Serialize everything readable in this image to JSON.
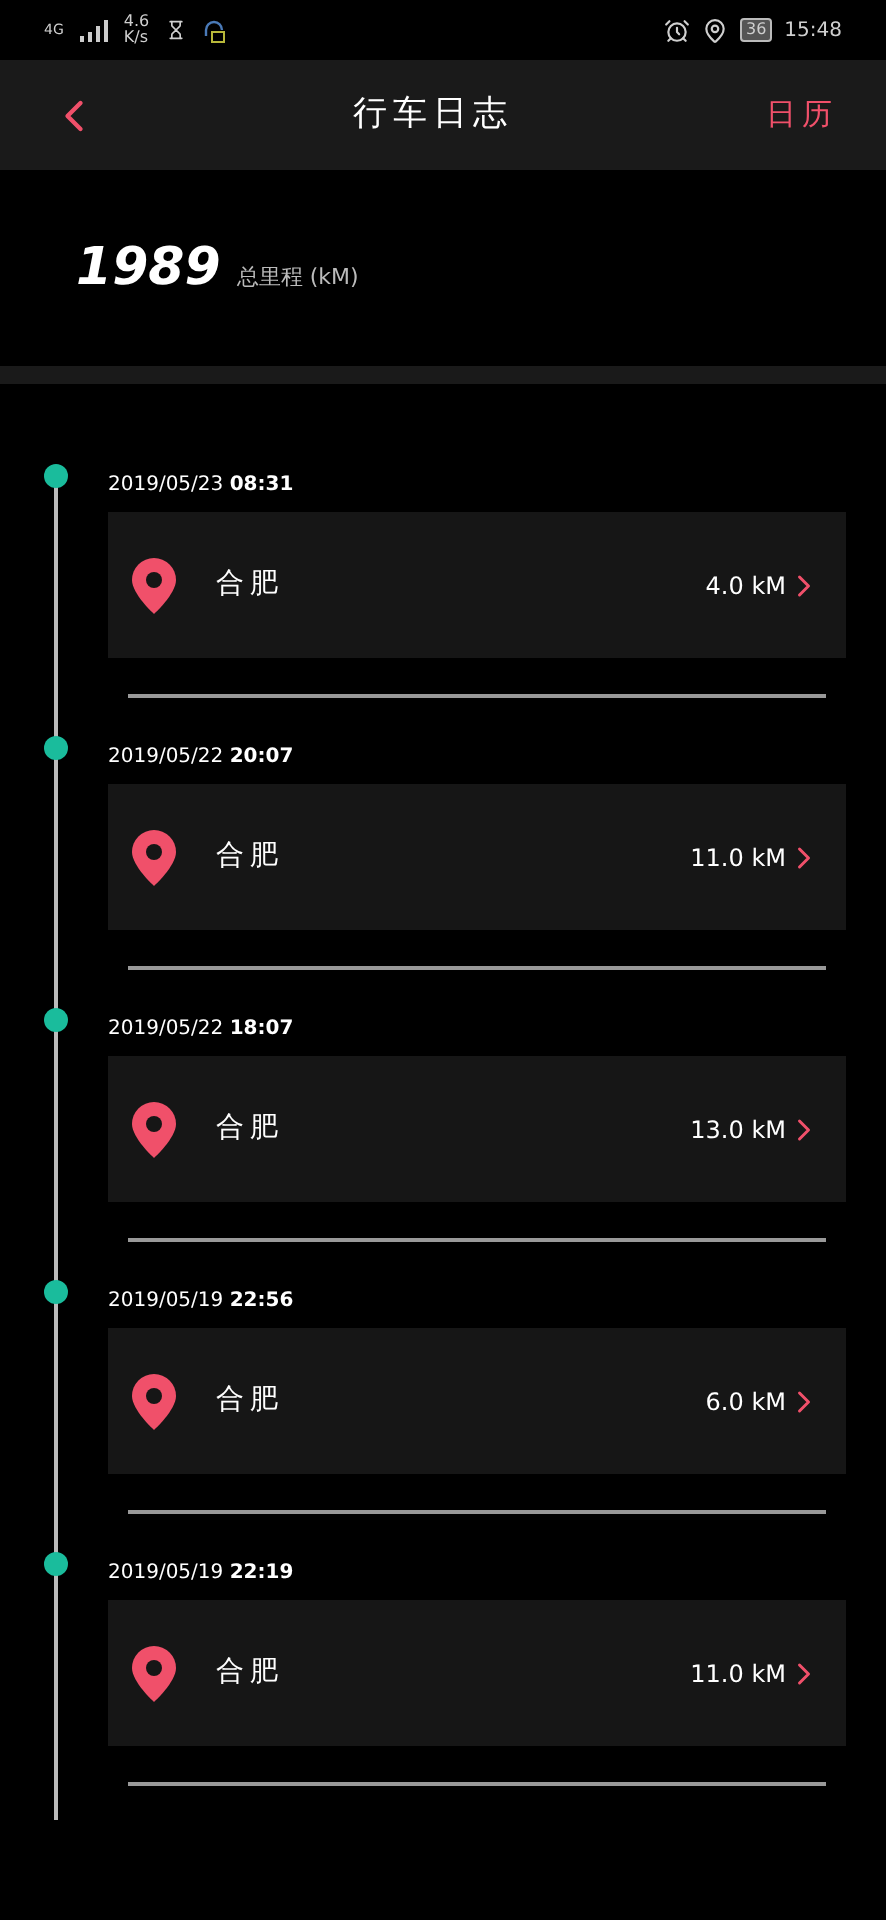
{
  "status_bar": {
    "network": "4G",
    "speed": "4.6",
    "speed_unit": "K/s",
    "battery": "36",
    "time": "15:48"
  },
  "header": {
    "title": "行车日志",
    "action": "日历"
  },
  "summary": {
    "value": "1989",
    "label": "总里程 (kM)"
  },
  "trips": [
    {
      "date": "2019/05/23",
      "time": "08:31",
      "place": "合肥",
      "distance": "4.0 kM"
    },
    {
      "date": "2019/05/22",
      "time": "20:07",
      "place": "合肥",
      "distance": "11.0 kM"
    },
    {
      "date": "2019/05/22",
      "time": "18:07",
      "place": "合肥",
      "distance": "13.0 kM"
    },
    {
      "date": "2019/05/19",
      "time": "22:56",
      "place": "合肥",
      "distance": "6.0 kM"
    },
    {
      "date": "2019/05/19",
      "time": "22:19",
      "place": "合肥",
      "distance": "11.0 kM"
    }
  ]
}
